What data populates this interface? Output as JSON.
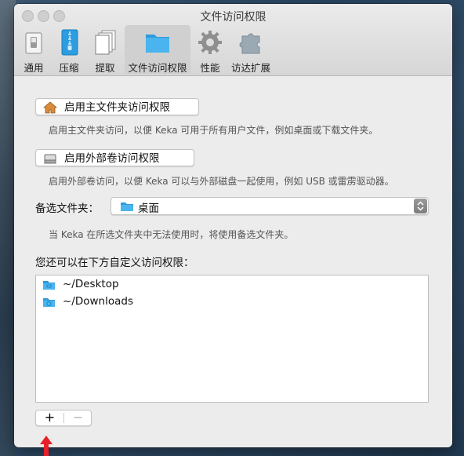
{
  "window": {
    "title": "文件访问权限"
  },
  "toolbar": {
    "tabs": [
      {
        "label": "通用",
        "icon": "switch-icon"
      },
      {
        "label": "压缩",
        "icon": "archive-icon"
      },
      {
        "label": "提取",
        "icon": "documents-icon"
      },
      {
        "label": "文件访问权限",
        "icon": "folder-icon",
        "selected": true
      },
      {
        "label": "性能",
        "icon": "gear-icon"
      },
      {
        "label": "访达扩展",
        "icon": "puzzle-icon"
      }
    ]
  },
  "home_access": {
    "button_label": "启用主文件夹访问权限",
    "description": "启用主文件夹访问，以便 Keka 可用于所有用户文件，例如桌面或下载文件夹。"
  },
  "volume_access": {
    "button_label": "启用外部卷访问权限",
    "description": "启用外部卷访问，以便 Keka 可以与外部磁盘一起使用，例如 USB 或雷雳驱动器。"
  },
  "fallback": {
    "label": "备选文件夹：",
    "selected": "桌面",
    "description": "当 Keka 在所选文件夹中无法使用时，将使用备选文件夹。"
  },
  "custom": {
    "label": "您还可以在下方自定义访问权限：",
    "items": [
      "~/Desktop",
      "~/Downloads"
    ],
    "add_label": "+",
    "remove_label": "−"
  },
  "colors": {
    "folder": "#3fa9e6",
    "annotation_arrow": "#e8202a"
  }
}
